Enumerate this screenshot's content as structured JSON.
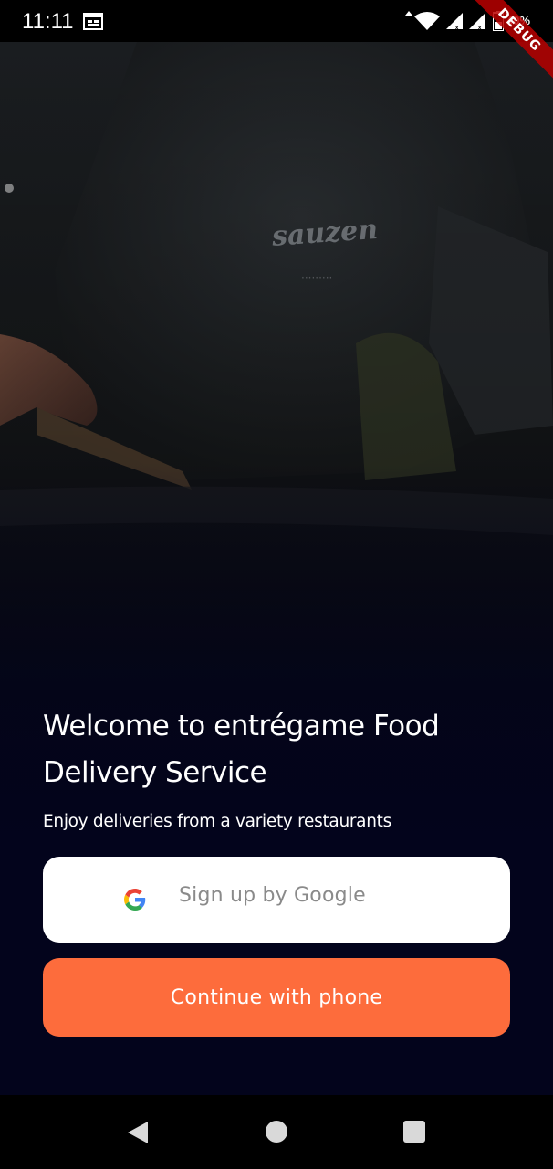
{
  "status_bar": {
    "time": "11:11",
    "battery": "40%"
  },
  "debug_banner": {
    "label": "DEBUG"
  },
  "welcome": {
    "title": "Welcome to entrégame Food Delivery Service",
    "subtitle": "Enjoy deliveries from a variety restaurants"
  },
  "buttons": {
    "google_label": "Sign up by Google",
    "phone_label": "Continue with phone"
  },
  "colors": {
    "accent": "#fd6c3c",
    "background": "#03041c",
    "google_button_bg": "#ffffff",
    "google_label": "#8a8a8a"
  },
  "icons": {
    "calendar": "calendar-icon",
    "wifi": "wifi-icon",
    "signal": "signal-icon",
    "battery": "battery-icon",
    "google": "google-icon",
    "nav_back": "back-triangle-icon",
    "nav_home": "home-circle-icon",
    "nav_recents": "recents-square-icon"
  }
}
